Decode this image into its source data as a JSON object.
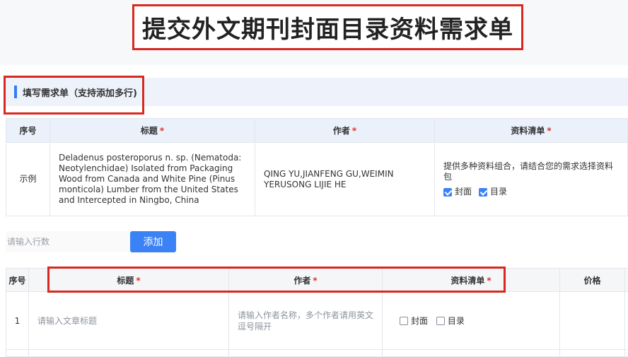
{
  "page": {
    "title": "提交外文期刊封面目录资料需求单"
  },
  "section": {
    "title": "填写需求单（支持添加多行)"
  },
  "example_table": {
    "headers": {
      "index": "序号",
      "title": "标题",
      "author": "作者",
      "materials": "资料清单",
      "required_mark": "*"
    },
    "row": {
      "index": "示例",
      "title": "Deladenus posteroporus n. sp. (Nematoda: Neotylenchidae) Isolated from Packaging Wood from Canada and White Pine (Pinus monticola) Lumber from the United States and Intercepted in Ningbo, China",
      "author": "QING YU,JIANFENG GU,WEIMIN YERUSONG LIJIE HE",
      "materials_desc": "提供多种资料组合，请结合您的需求选择资料包",
      "option_cover": "封面",
      "option_toc": "目录"
    }
  },
  "controls": {
    "rows_placeholder": "请输入行数",
    "add_label": "添加"
  },
  "input_table": {
    "headers": {
      "index": "序号",
      "title": "标题",
      "author": "作者",
      "materials": "资料清单",
      "price": "价格",
      "required_mark": "*"
    },
    "row": {
      "index": "1",
      "title_placeholder": "请输入文章标题",
      "author_placeholder": "请输入作者名称，多个作者请用英文逗号隔开",
      "option_cover": "封面",
      "option_toc": "目录"
    }
  },
  "colors": {
    "accent": "#3b82f6",
    "highlight_red": "#d8281f",
    "required_red": "#e0312a",
    "header_bg": "#eaf1fb"
  },
  "icons": [
    "checkbox-checked-icon",
    "checkbox-unchecked-icon"
  ]
}
